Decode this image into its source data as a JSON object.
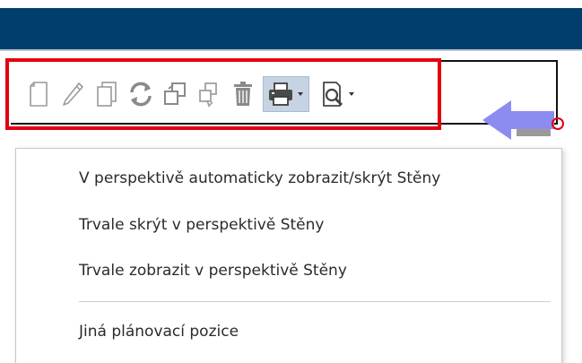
{
  "window": {
    "title_bar_color": "#003e6e"
  },
  "toolbar": {
    "highlight_color": "#e2000f",
    "buttons": [
      {
        "name": "new",
        "icon": "new-document-icon"
      },
      {
        "name": "edit",
        "icon": "pencil-icon"
      },
      {
        "name": "copy",
        "icon": "copy-icon"
      },
      {
        "name": "refresh",
        "icon": "refresh-icon"
      },
      {
        "name": "duplicate",
        "icon": "duplicate-icon"
      },
      {
        "name": "move",
        "icon": "move-icon"
      },
      {
        "name": "delete",
        "icon": "trash-icon"
      },
      {
        "name": "print",
        "icon": "print-icon",
        "active": true,
        "dropdown": true
      },
      {
        "name": "preview",
        "icon": "print-preview-icon",
        "dropdown": true
      }
    ]
  },
  "indicator": {
    "arrow_color": "#8c8cf0",
    "circle_color": "#e2000f"
  },
  "context_menu": {
    "items": [
      {
        "label": "V perspektivě automaticky zobrazit/skrýt Stěny"
      },
      {
        "label": "Trvale skrýt v perspektivě Stěny"
      },
      {
        "label": "Trvale zobrazit v perspektivě Stěny"
      },
      {
        "label": "Jiná plánovací pozice"
      }
    ]
  }
}
